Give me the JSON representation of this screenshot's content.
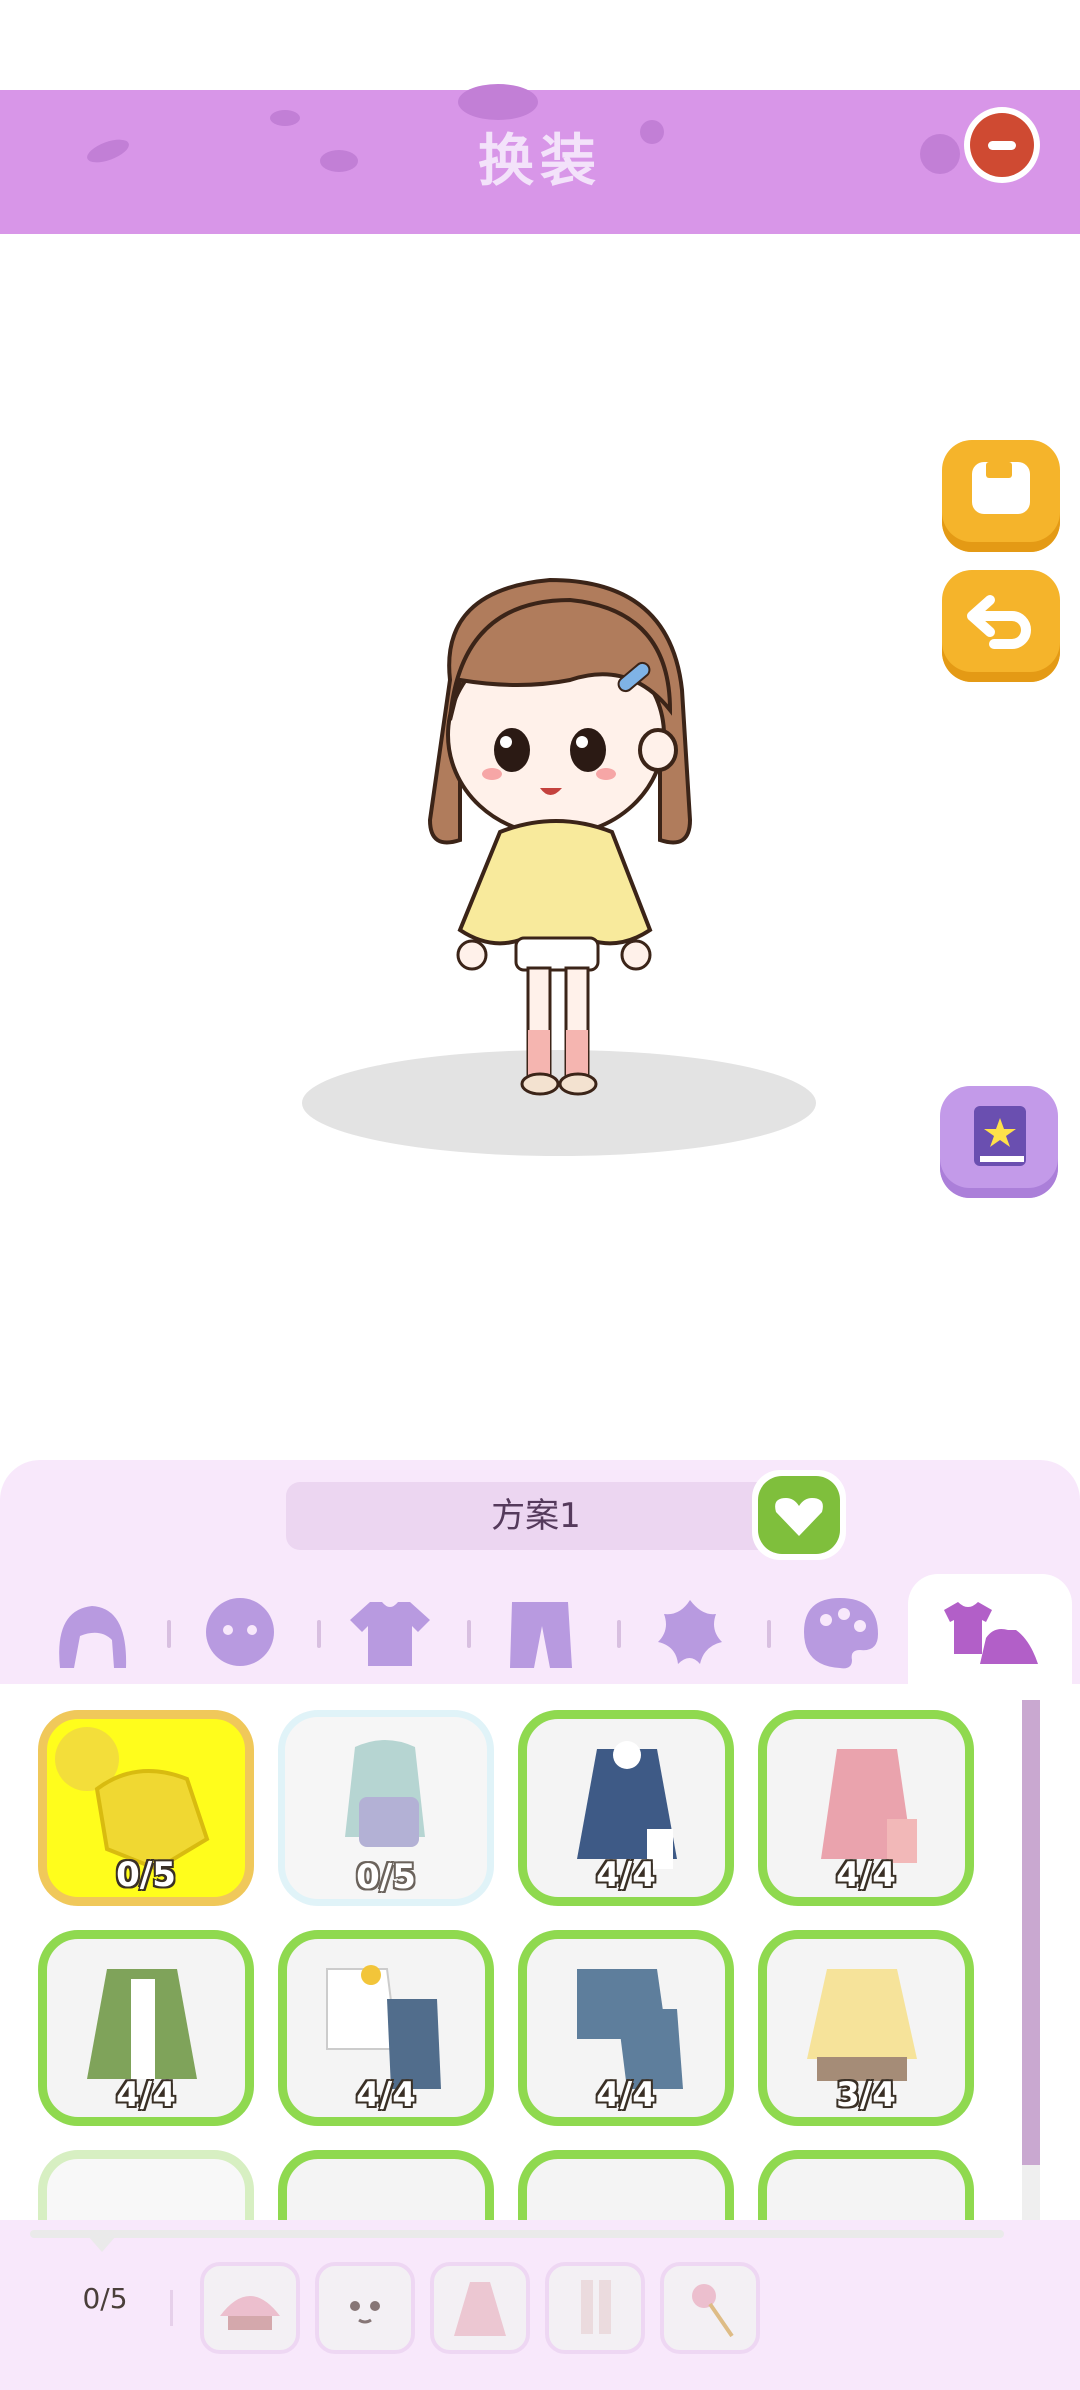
{
  "header": {
    "title": "换装"
  },
  "scheme": {
    "name": "方案1"
  },
  "tabs": [
    {
      "name": "hair"
    },
    {
      "name": "face"
    },
    {
      "name": "top"
    },
    {
      "name": "bottom"
    },
    {
      "name": "accessory"
    },
    {
      "name": "palette"
    },
    {
      "name": "outfit",
      "active": true
    }
  ],
  "items": [
    {
      "count": "0/5",
      "state": "selected"
    },
    {
      "count": "0/5",
      "state": "locked"
    },
    {
      "count": "4/4",
      "state": "owned"
    },
    {
      "count": "4/4",
      "state": "owned"
    },
    {
      "count": "4/4",
      "state": "owned"
    },
    {
      "count": "4/4",
      "state": "owned"
    },
    {
      "count": "4/4",
      "state": "owned"
    },
    {
      "count": "3/4",
      "state": "owned"
    }
  ],
  "equipped": {
    "count": "0/5"
  },
  "colors": {
    "header": "#d896e8",
    "accent_green": "#8fd94f",
    "button_yellow": "#f5b42b"
  }
}
